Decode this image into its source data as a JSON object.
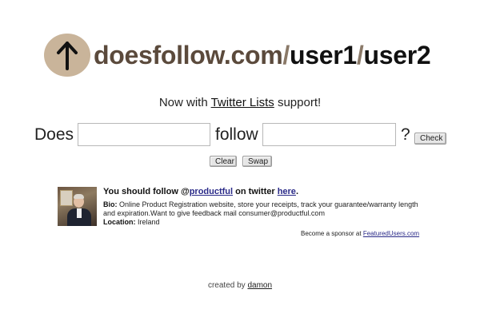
{
  "logo": {
    "icon": "arrow-up-icon",
    "circle_color": "#c9b49a",
    "domain": "doesfollow.com",
    "slash1": "/",
    "user1": "user1",
    "slash2": "/",
    "user2": "user2"
  },
  "tagline": {
    "prefix": "Now with ",
    "link": "Twitter Lists",
    "suffix": " support!"
  },
  "form": {
    "does_label": "Does",
    "user1_value": "",
    "follow_label": "follow",
    "user2_value": "",
    "question_mark": "?",
    "check_button": "Check",
    "clear_button": "Clear",
    "swap_button": "Swap"
  },
  "sponsor": {
    "headline_prefix": "You should follow @",
    "handle": "productful",
    "headline_middle": " on twitter ",
    "here_link": "here",
    "headline_suffix": ".",
    "bio_label": "Bio:",
    "bio_text": " Online Product Registration website, store your receipts, track your guarantee/warranty length and expiration.Want to give feedback mail consumer@productful.com",
    "location_label": "Location:",
    "location_text": " Ireland",
    "become_text": "Become a sponsor at ",
    "become_link": "FeaturedUsers.com"
  },
  "footer": {
    "created_by": "created by ",
    "author_link": "damon"
  },
  "colors": {
    "domain_text": "#5b4a3c",
    "link_blue": "#2a2a88"
  }
}
